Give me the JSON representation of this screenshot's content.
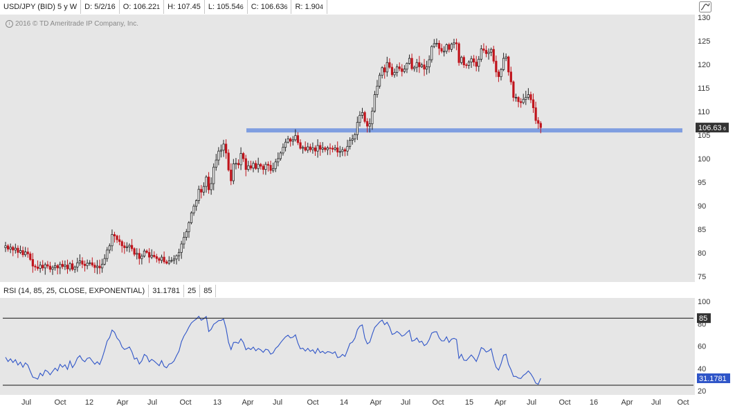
{
  "header": {
    "symbol": "USD/JPY (BID) 5 y W",
    "date": "D: 5/2/16",
    "open_label": "O: 106.22",
    "open_sub": "1",
    "high_label": "H: 107.45",
    "low_label": "L: 105.54",
    "low_sub": "6",
    "close_label": "C: 106.63",
    "close_sub": "6",
    "range_label": "R: 1.90",
    "range_sub": "4"
  },
  "copyright": "2016 © TD Ameritrade IP Company, Inc.",
  "rsi_header": {
    "label": "RSI (14, 85, 25, CLOSE, EXPONENTIAL)",
    "value": "31.1781",
    "low": "25",
    "high": "85"
  },
  "price_tag": "106.63",
  "price_tag_sub": "6",
  "rsi_tag": "31.1781",
  "rsi_level_tag": "85",
  "x_ticks": [
    "Jul",
    "Oct",
    "12",
    "Apr",
    "Jul",
    "Oct",
    "13",
    "Apr",
    "Jul",
    "Oct",
    "14",
    "Apr",
    "Jul",
    "Oct",
    "15",
    "Apr",
    "Jul",
    "Oct",
    "16",
    "Apr",
    "Jul",
    "Oct"
  ],
  "colors": {
    "up": "#222222",
    "down": "#c0141c",
    "support": "#7f9ee0",
    "rsi": "#2f55c8",
    "panel": "#e6e6e6"
  },
  "chart_data": [
    {
      "type": "candlestick",
      "title": "USD/JPY (BID) 5 y W",
      "ylim": [
        74,
        131
      ],
      "y_ticks": [
        75,
        80,
        85,
        90,
        95,
        100,
        105,
        110,
        115,
        120,
        125,
        130
      ],
      "support_level": 106.0,
      "x_start": "2011-05-30",
      "weekly_closes": [
        81.5,
        80.8,
        81.2,
        80.6,
        81.0,
        80.1,
        80.5,
        79.6,
        80.2,
        79.8,
        78.6,
        77.2,
        77.0,
        76.7,
        77.4,
        76.8,
        77.5,
        77.2,
        76.5,
        76.9,
        77.3,
        76.8,
        77.6,
        77.1,
        77.4,
        76.6,
        77.7,
        76.5,
        77.0,
        77.9,
        78.3,
        77.6,
        77.3,
        77.8,
        77.9,
        77.4,
        76.9,
        77.2,
        76.8,
        77.6,
        78.8,
        80.6,
        81.5,
        83.9,
        83.6,
        82.8,
        82.4,
        81.5,
        81.1,
        81.3,
        81.6,
        80.9,
        79.7,
        79.9,
        78.8,
        79.3,
        80.4,
        80.1,
        79.1,
        79.5,
        79.2,
        78.8,
        78.4,
        79.1,
        78.1,
        77.8,
        78.3,
        78.4,
        78.7,
        79.4,
        80.1,
        81.9,
        83.3,
        84.5,
        86.4,
        88.5,
        89.9,
        91.1,
        93.5,
        92.9,
        94.1,
        96.1,
        93.4,
        94.7,
        98.2,
        99.7,
        101.6,
        101.8,
        103.1,
        101.2,
        97.6,
        95.3,
        98.9,
        99.0,
        98.7,
        101.1,
        100.0,
        97.7,
        98.5,
        98.0,
        99.0,
        97.9,
        98.8,
        98.4,
        97.7,
        98.8,
        98.6,
        97.5,
        97.9,
        99.3,
        100.0,
        101.2,
        102.4,
        103.5,
        104.2,
        103.7,
        104.0,
        104.9,
        103.4,
        102.2,
        102.4,
        101.8,
        102.5,
        101.9,
        102.3,
        101.6,
        102.8,
        102.0,
        102.3,
        101.9,
        102.3,
        102.2,
        102.0,
        102.3,
        101.4,
        101.5,
        101.9,
        101.6,
        102.6,
        103.9,
        104.2,
        105.1,
        107.7,
        109.2,
        109.8,
        107.9,
        106.9,
        107.4,
        110.1,
        113.6,
        115.4,
        117.7,
        119.3,
        118.4,
        120.4,
        119.4,
        117.8,
        118.3,
        119.5,
        119.1,
        118.5,
        119.0,
        120.2,
        121.3,
        119.1,
        119.4,
        120.4,
        119.5,
        119.9,
        119.0,
        119.5,
        121.0,
        123.8,
        124.4,
        124.5,
        123.4,
        122.8,
        122.8,
        124.2,
        123.2,
        124.3,
        124.6,
        124.4,
        120.4,
        121.5,
        119.9,
        119.8,
        120.5,
        121.2,
        120.5,
        119.6,
        121.1,
        123.3,
        123.0,
        122.3,
        122.6,
        123.2,
        120.7,
        118.4,
        117.4,
        118.9,
        121.3,
        121.6,
        118.4,
        116.3,
        113.0,
        113.0,
        112.1,
        111.9,
        112.6,
        113.0,
        113.6,
        112.5,
        110.8,
        108.1,
        107.5,
        106.6
      ],
      "series": [
        {
          "name": "USD/JPY (BID) 5 y W"
        }
      ]
    },
    {
      "type": "line",
      "title": "RSI (14, 85, 25, CLOSE, EXPONENTIAL)",
      "ylim": [
        18,
        102
      ],
      "y_ticks": [
        20,
        40,
        60,
        80,
        100
      ],
      "levels": [
        85,
        25
      ],
      "last_value": 31.1781,
      "series": [
        {
          "name": "RSI (14, 85, 25, CLOSE, EXPONENTIAL)"
        }
      ]
    }
  ]
}
